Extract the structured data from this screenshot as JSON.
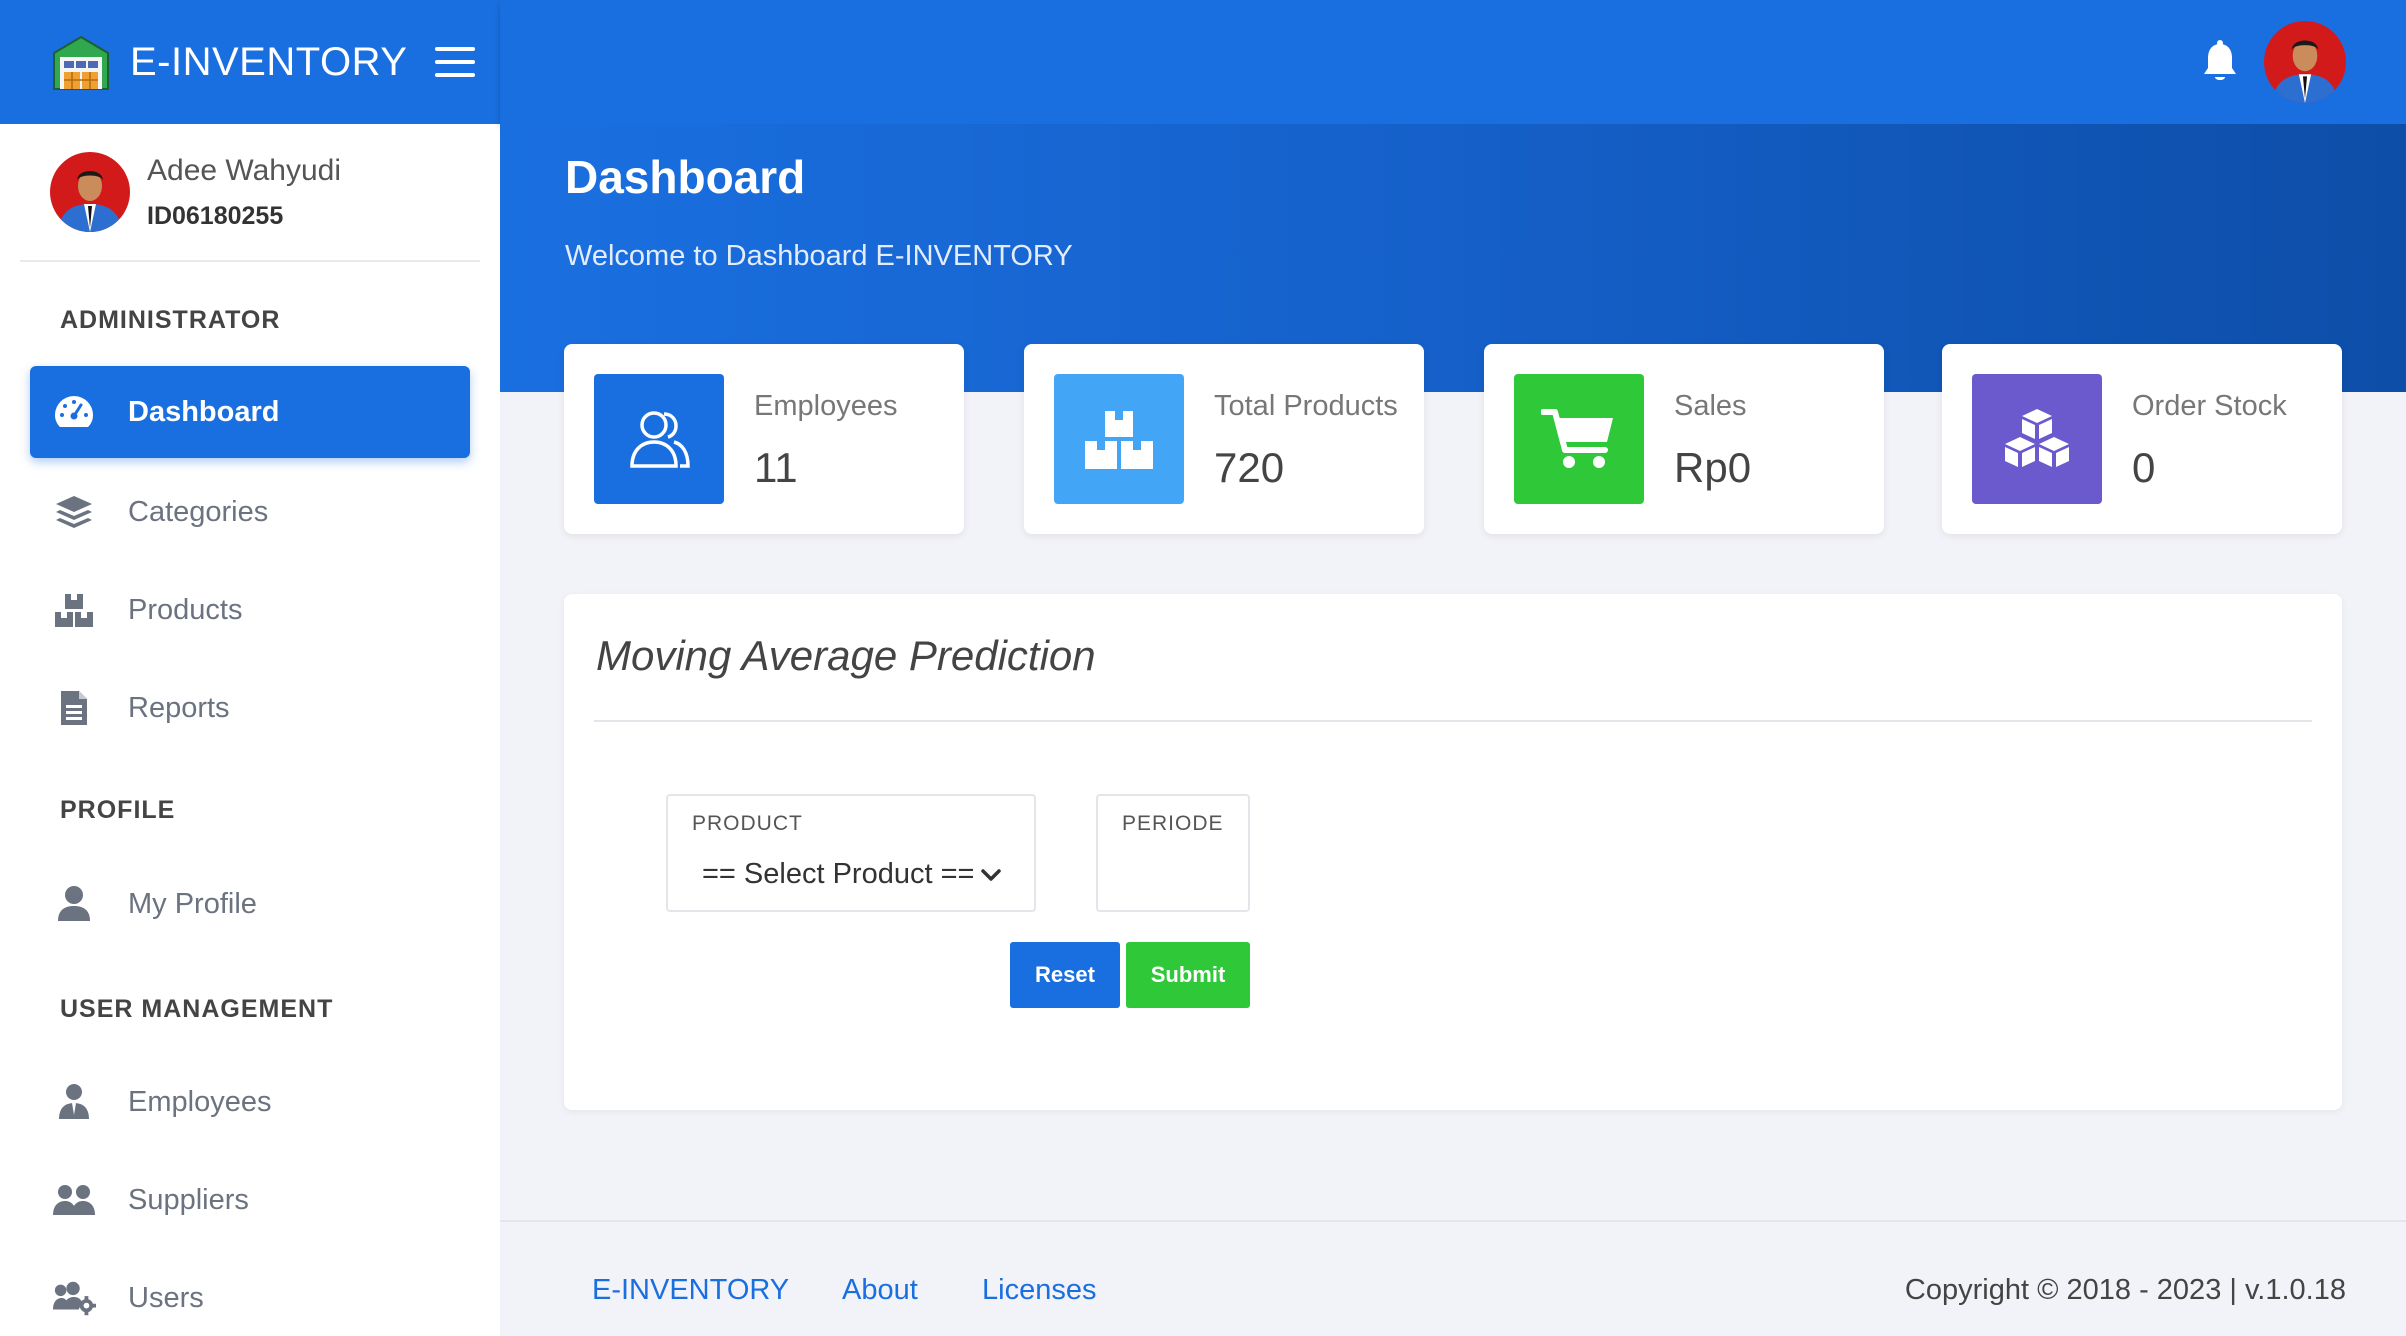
{
  "brand": {
    "name": "E-INVENTORY"
  },
  "user": {
    "name": "Adee Wahyudi",
    "id": "ID06180255"
  },
  "sidebar": {
    "sections": [
      {
        "title": "ADMINISTRATOR"
      },
      {
        "title": "PROFILE"
      },
      {
        "title": "USER MANAGEMENT"
      }
    ],
    "items": [
      {
        "label": "Dashboard",
        "icon": "dashboard-gauge-icon",
        "active": true
      },
      {
        "label": "Categories",
        "icon": "layers-icon"
      },
      {
        "label": "Products",
        "icon": "boxes-icon"
      },
      {
        "label": "Reports",
        "icon": "document-icon"
      },
      {
        "label": "My Profile",
        "icon": "user-icon"
      },
      {
        "label": "Employees",
        "icon": "user-tie-icon"
      },
      {
        "label": "Suppliers",
        "icon": "users-icon"
      },
      {
        "label": "Users",
        "icon": "users-gear-icon"
      }
    ]
  },
  "header": {
    "title": "Dashboard",
    "subtitle": "Welcome to Dashboard E-INVENTORY"
  },
  "stats": [
    {
      "label": "Employees",
      "value": "11",
      "color": "#1a6fe0",
      "icon": "users-outline-icon"
    },
    {
      "label": "Total Products",
      "value": "720",
      "color": "#42a5f5",
      "icon": "boxes-icon"
    },
    {
      "label": "Sales",
      "value": "Rp0",
      "color": "#2ec839",
      "icon": "cart-icon"
    },
    {
      "label": "Order Stock",
      "value": "0",
      "color": "#6a5acd",
      "icon": "cubes-icon"
    }
  ],
  "panel": {
    "title": "Moving Average Prediction",
    "product_label": "PRODUCT",
    "product_selected": "== Select Product ==",
    "periode_label": "PERIODE",
    "periode_value": "",
    "reset_label": "Reset",
    "submit_label": "Submit"
  },
  "footer": {
    "links": [
      "E-INVENTORY",
      "About",
      "Licenses"
    ],
    "copyright": "Copyright © 2018 - 2023 | v.1.0.18"
  },
  "colors": {
    "primary": "#1a6fe0",
    "success": "#2ec839",
    "info": "#42a5f5",
    "purple": "#6a5acd"
  }
}
